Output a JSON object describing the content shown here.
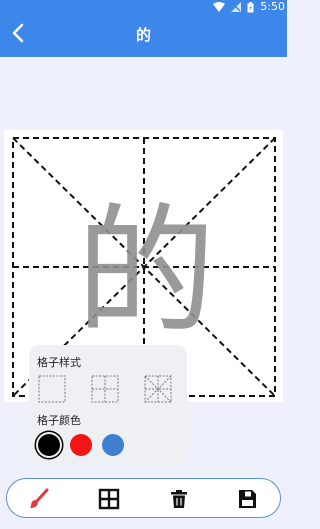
{
  "status_bar": {
    "time": "5:50",
    "color": "#3d86ea"
  },
  "header": {
    "title": "的",
    "back_icon": "chevron-left-icon"
  },
  "canvas": {
    "character": "的",
    "grid_style": "米字格",
    "stroke_color": "#000000"
  },
  "grid_panel": {
    "style_label": "格子样式",
    "color_label": "格子颜色",
    "styles": [
      "blank-grid-icon",
      "tian-grid-icon",
      "mi-grid-icon"
    ],
    "colors": [
      "#000000",
      "#f21515",
      "#3f7fd0"
    ],
    "selected_color": "#000000"
  },
  "toolbar": {
    "tools": [
      "brush-icon",
      "grid-icon",
      "trash-icon",
      "save-icon"
    ],
    "brush_color": "#e0383e"
  }
}
